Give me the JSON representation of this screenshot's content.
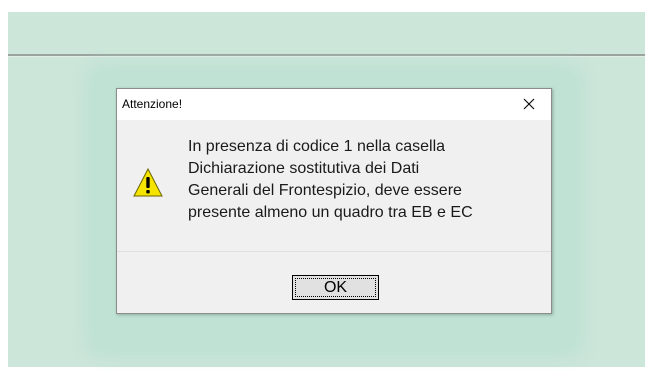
{
  "dialog": {
    "title": "Attenzione!",
    "icon": "warning-icon",
    "message": "In presenza di codice 1 nella casella\nDichiarazione sostitutiva dei Dati\nGenerali del Frontespizio, deve essere\npresente almeno un quadro tra EB e EC",
    "ok_label": "OK",
    "close_icon": "close-icon"
  },
  "colors": {
    "app_background": "#cce6d9",
    "dialog_content_background": "#f0f0f0",
    "warning_fill": "#f5e400",
    "button_background": "#e1e1e1"
  }
}
